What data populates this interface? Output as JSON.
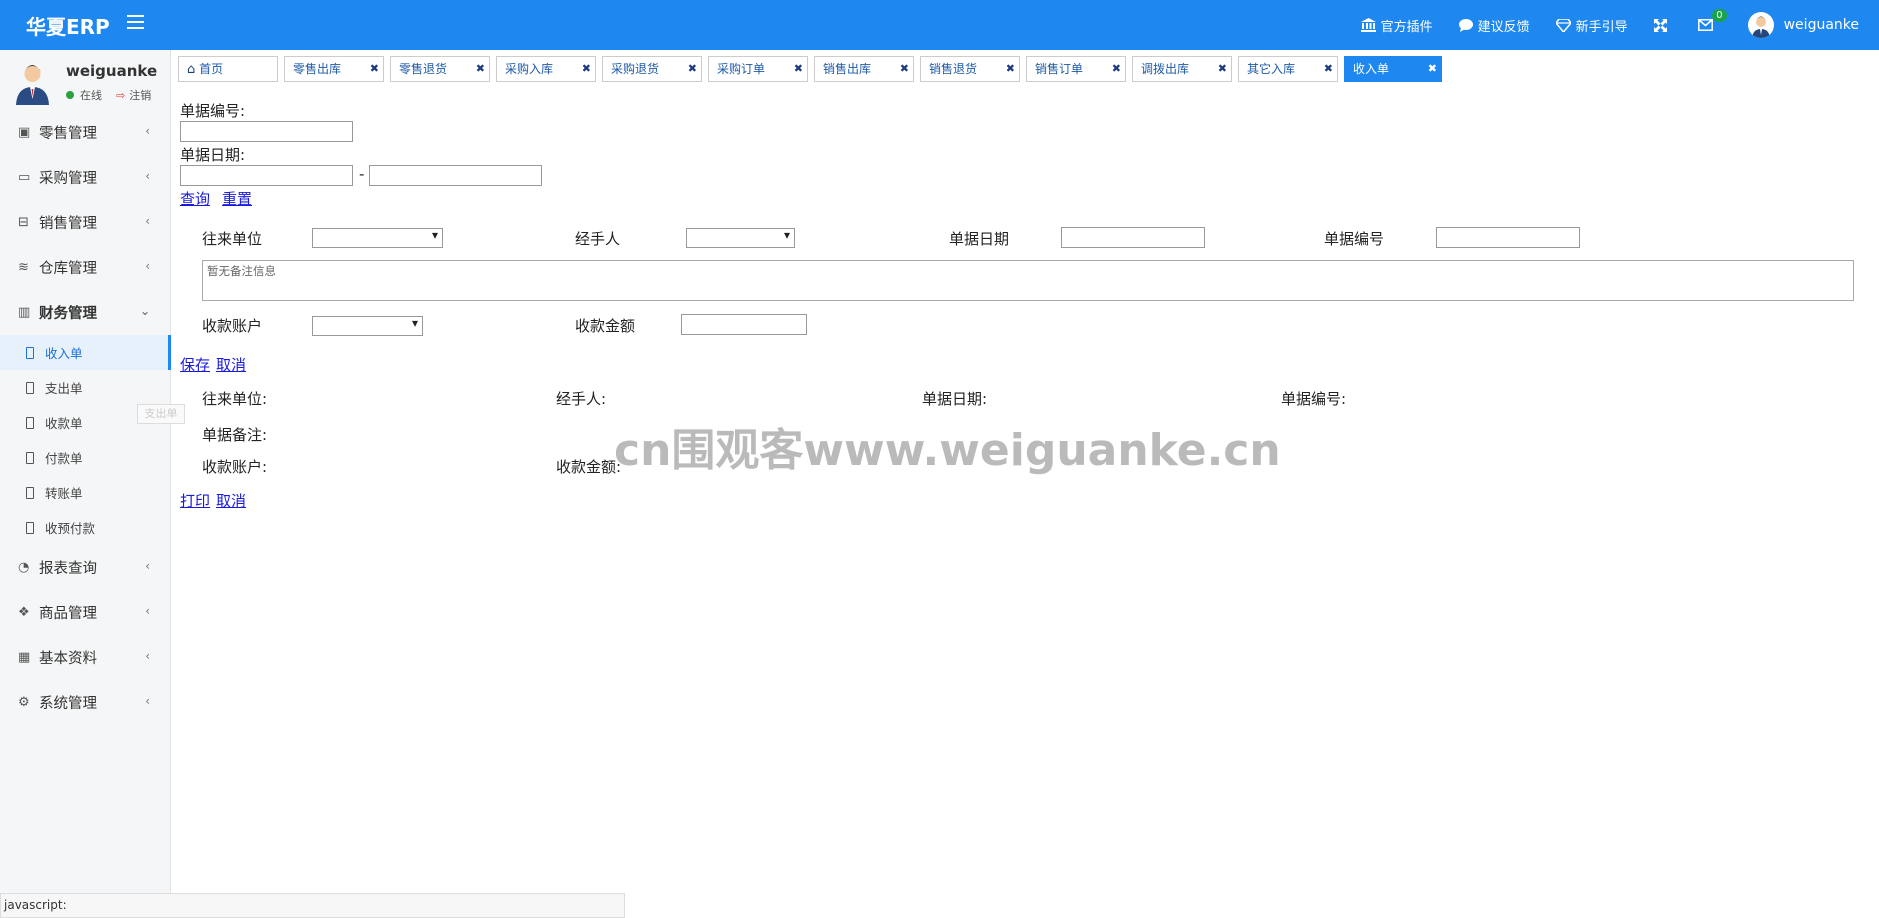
{
  "header": {
    "brand": "华夏ERP",
    "links": [
      "官方插件",
      "建议反馈",
      "新手引导"
    ],
    "mail_count": "0",
    "username": "weiguanke"
  },
  "profile": {
    "name": "weiguanke",
    "status": "在线",
    "logout": "注销"
  },
  "sidebar": {
    "menus_top": [
      "零售管理",
      "采购管理",
      "销售管理",
      "仓库管理"
    ],
    "finance": "财务管理",
    "finance_items": [
      "收入单",
      "支出单",
      "收款单",
      "付款单",
      "转账单",
      "收预付款"
    ],
    "menus_bottom": [
      "报表查询",
      "商品管理",
      "基本资料",
      "系统管理"
    ],
    "tooltip": "支出单"
  },
  "tabs": {
    "home": "首页",
    "items": [
      "零售出库",
      "零售退货",
      "采购入库",
      "采购退货",
      "采购订单",
      "销售出库",
      "销售退货",
      "销售订单",
      "调拨出库",
      "其它入库"
    ],
    "active": "收入单"
  },
  "search": {
    "bill_no_label": "单据编号:",
    "bill_date_label": "单据日期:",
    "date_sep": "-",
    "query": "查询",
    "reset": "重置"
  },
  "form": {
    "org_label": "往来单位",
    "handler_label": "经手人",
    "date_label": "单据日期",
    "no_label": "单据编号",
    "memo_placeholder": "暂无备注信息",
    "account_label": "收款账户",
    "amount_label": "收款金额",
    "save": "保存",
    "cancel": "取消"
  },
  "detail": {
    "org_label": "往来单位:",
    "handler_label": "经手人:",
    "date_label": "单据日期:",
    "no_label": "单据编号:",
    "memo_label": "单据备注:",
    "account_label": "收款账户:",
    "amount_label": "收款金额:",
    "print": "打印",
    "cancel": "取消"
  },
  "status_bar": "javascript:",
  "watermark": "cn围观客www.weiguanke.cn",
  "colors": {
    "accent": "#1e88f0",
    "badge": "#1aa34a"
  }
}
